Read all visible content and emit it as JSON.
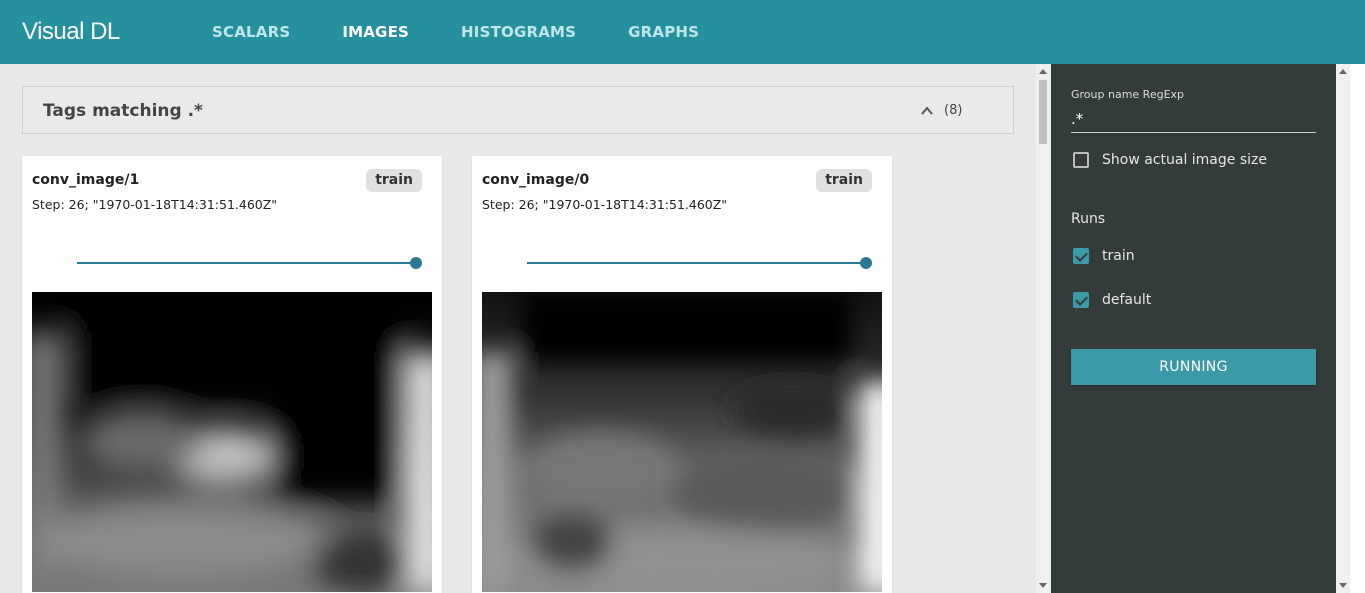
{
  "app": {
    "logo": "Visual DL"
  },
  "nav": [
    {
      "label": "SCALARS",
      "active": false
    },
    {
      "label": "IMAGES",
      "active": true
    },
    {
      "label": "HISTOGRAMS",
      "active": false
    },
    {
      "label": "GRAPHS",
      "active": false
    }
  ],
  "tags_header": {
    "title": "Tags matching .*",
    "count": "(8)"
  },
  "cards": [
    {
      "title": "conv_image/1",
      "run": "train",
      "step": "Step: 26; \"1970-01-18T14:31:51.460Z\"",
      "slider": 1.0
    },
    {
      "title": "conv_image/0",
      "run": "train",
      "step": "Step: 26; \"1970-01-18T14:31:51.460Z\"",
      "slider": 1.0
    }
  ],
  "sidebar": {
    "group_label": "Group name RegExp",
    "group_value": ".*",
    "show_actual_size_label": "Show actual image size",
    "show_actual_size_checked": false,
    "runs_label": "Runs",
    "runs": [
      {
        "label": "train",
        "checked": true
      },
      {
        "label": "default",
        "checked": true
      }
    ],
    "running_button": "RUNNING"
  },
  "colors": {
    "topbar": "#25919f",
    "sidebar": "#333b3b",
    "accent": "#3a9aa8"
  }
}
